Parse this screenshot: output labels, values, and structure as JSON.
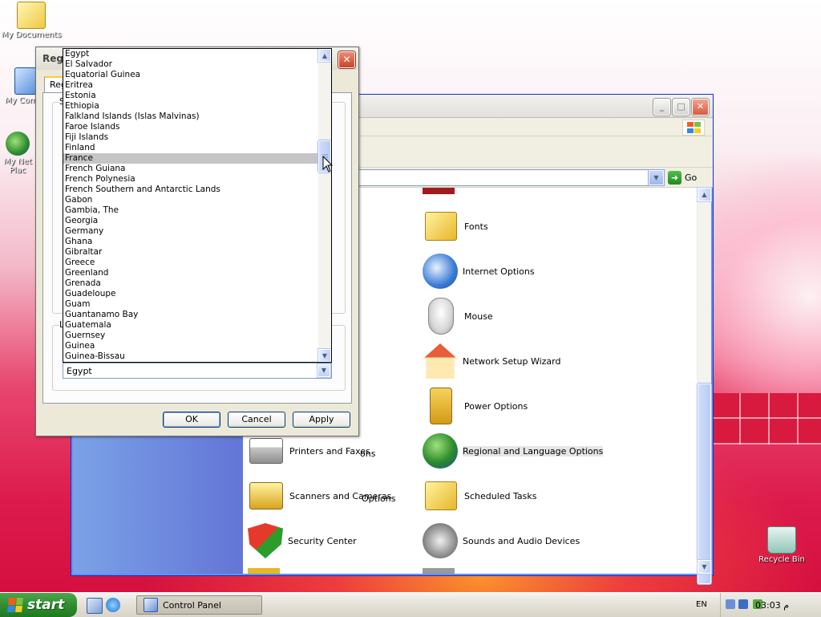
{
  "desktop": {
    "icons": [
      {
        "label": "My Documents"
      },
      {
        "label": "My Com"
      },
      {
        "label": "My Net"
      },
      {
        "label": "Plac"
      },
      {
        "label": "Recycle Bin"
      }
    ]
  },
  "control_panel": {
    "address_go": "Go",
    "items": [
      {
        "label": "Fonts",
        "icon": "fonts-folder-icon"
      },
      {
        "label": "Internet Options",
        "icon": "internet-options-icon"
      },
      {
        "label": "Mouse",
        "icon": "mouse-icon"
      },
      {
        "label": "Network Setup Wizard",
        "icon": "network-house-icon"
      },
      {
        "label": "Power Options",
        "icon": "power-options-icon"
      },
      {
        "label": "Regional and Language Options",
        "icon": "globe-icon",
        "selected": true
      },
      {
        "label": "Scheduled Tasks",
        "icon": "scheduled-tasks-icon"
      },
      {
        "label": "Sounds and Audio Devices",
        "icon": "speaker-icon"
      },
      {
        "label": "Printers and Faxes",
        "icon": "printer-icon"
      },
      {
        "label": "Scanners and Cameras",
        "icon": "scanner-icon"
      },
      {
        "label": "Security Center",
        "icon": "security-shield-icon"
      }
    ],
    "partial_left_labels": [
      "ons",
      "Options"
    ]
  },
  "dialog": {
    "title": "Regi",
    "tab_label": "Reg",
    "group1_letter": "S",
    "group2_letter": "L",
    "buttons": {
      "ok": "OK",
      "cancel": "Cancel",
      "apply": "Apply"
    },
    "combo_value": "Egypt",
    "dropdown_items": [
      "Egypt",
      "El Salvador",
      "Equatorial Guinea",
      "Eritrea",
      "Estonia",
      "Ethiopia",
      "Falkland Islands (Islas Malvinas)",
      "Faroe Islands",
      "Fiji Islands",
      "Finland",
      "France",
      "French Guiana",
      "French Polynesia",
      "French Southern and Antarctic Lands",
      "Gabon",
      "Gambia, The",
      "Georgia",
      "Germany",
      "Ghana",
      "Gibraltar",
      "Greece",
      "Greenland",
      "Grenada",
      "Guadeloupe",
      "Guam",
      "Guantanamo Bay",
      "Guatemala",
      "Guernsey",
      "Guinea",
      "Guinea-Bissau"
    ],
    "dropdown_selected": "France"
  },
  "taskbar": {
    "start_label": "start",
    "task_label": "Control Panel",
    "language": "EN",
    "clock": "03:03 م"
  }
}
